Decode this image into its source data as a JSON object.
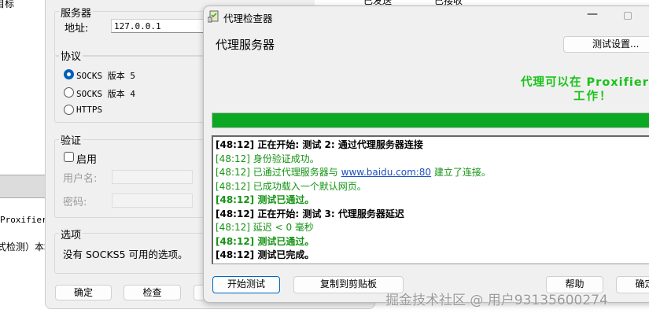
{
  "background": {
    "left_title": "目标",
    "proxifier_text": "Proxifier",
    "detect_text": "式检测）本地",
    "col_sent": "已发送",
    "col_received": "已接收"
  },
  "proxy_dialog": {
    "server_group": "服务器",
    "address_label": "地址:",
    "address_value": "127.0.0.1",
    "protocol_group": "协议",
    "protocols": [
      {
        "label": "SOCKS 版本 5",
        "selected": true
      },
      {
        "label": "SOCKS 版本 4",
        "selected": false
      },
      {
        "label": "HTTPS",
        "selected": false
      }
    ],
    "auth_group": "验证",
    "enable_label": "启用",
    "enable_checked": false,
    "username_label": "用户名:",
    "password_label": "密码:",
    "options_group": "选项",
    "options_text": "没有 SOCKS5 可用的选项。",
    "ok_button": "确定",
    "check_button": "检查"
  },
  "checker": {
    "title": "代理检查器",
    "heading": "代理服务器",
    "settings_button": "测试设置...",
    "result_line1": "代理可以在 Proxifier",
    "result_line2": "工作！",
    "progress_percent": 100,
    "colors": {
      "success": "#17c317",
      "progress": "#0aa823",
      "log_green": "#149414"
    },
    "log": [
      {
        "time": "[48:12]",
        "text": "正在开始: 测试 2: 通过代理服务器连接",
        "style": "bold-black"
      },
      {
        "time": "[48:12]",
        "text": "身份验证成功。",
        "style": "green"
      },
      {
        "time": "[48:12]",
        "text": "已通过代理服务器与",
        "link": "www.baidu.com:80",
        "after": "建立了连接。",
        "style": "green"
      },
      {
        "time": "[48:12]",
        "text": "已成功载入一个默认网页。",
        "style": "green"
      },
      {
        "time": "[48:12]",
        "text": "测试已通过。",
        "style": "bold-green"
      },
      {
        "time": "[48:12]",
        "text": "正在开始: 测试 3: 代理服务器延迟",
        "style": "bold-black"
      },
      {
        "time": "[48:12]",
        "text": "延迟 < 0 毫秒",
        "style": "green"
      },
      {
        "time": "[48:12]",
        "text": "测试已通过。",
        "style": "bold-green"
      },
      {
        "time": "[48:12]",
        "text": "测试已完成。",
        "style": "bold-black"
      }
    ],
    "start_button": "开始测试",
    "copy_button": "复制到剪贴板",
    "help_button": "帮助",
    "ok_button": "确定"
  },
  "watermark": "掘金技术社区 @ 用户93135600274"
}
